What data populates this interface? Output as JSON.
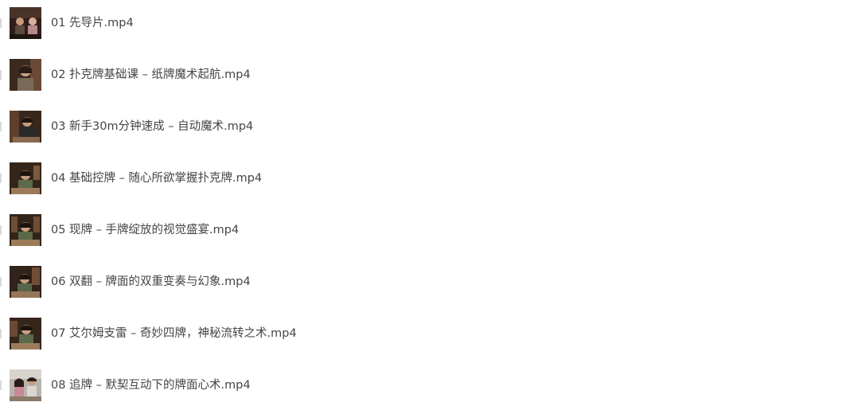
{
  "files": [
    {
      "name": "01 先导片.mp4",
      "thumbnail_icon": "video-thumbnail-icon"
    },
    {
      "name": "02 扑克牌基础课 – 纸牌魔术起航.mp4",
      "thumbnail_icon": "video-thumbnail-icon"
    },
    {
      "name": "03 新手30m分钟速成 – 自动魔术.mp4",
      "thumbnail_icon": "video-thumbnail-icon"
    },
    {
      "name": "04 基础控牌 – 随心所欲掌握扑克牌.mp4",
      "thumbnail_icon": "video-thumbnail-icon"
    },
    {
      "name": "05 现牌 – 手牌绽放的视觉盛宴.mp4",
      "thumbnail_icon": "video-thumbnail-icon"
    },
    {
      "name": "06 双翻 – 牌面的双重变奏与幻象.mp4",
      "thumbnail_icon": "video-thumbnail-icon"
    },
    {
      "name": "07 艾尔姆支雷 – 奇妙四牌，神秘流转之术.mp4",
      "thumbnail_icon": "video-thumbnail-icon"
    },
    {
      "name": "08 追牌 – 默契互动下的牌面心术.mp4",
      "thumbnail_icon": "video-thumbnail-icon"
    }
  ]
}
